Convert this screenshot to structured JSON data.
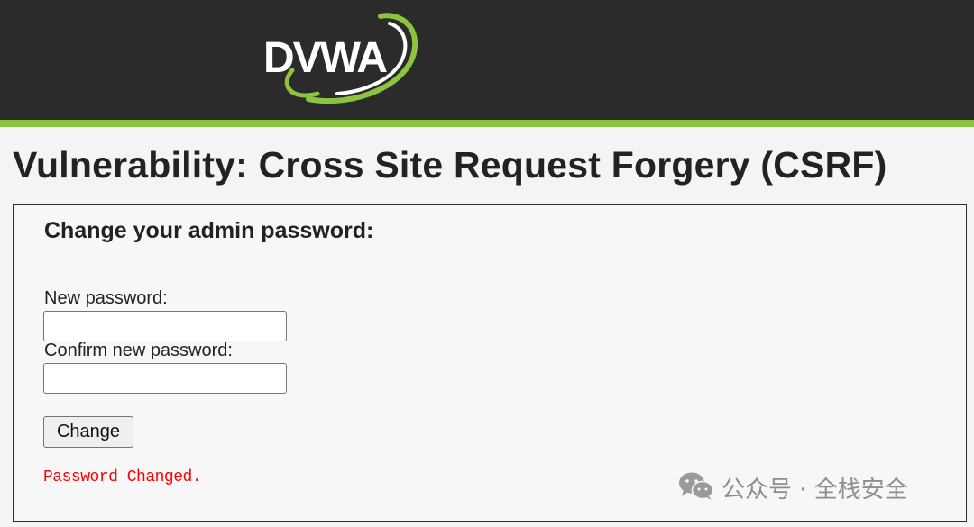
{
  "header": {
    "logo_text": "DVWA",
    "brand_color": "#8cc43f",
    "background_color": "#2b2b2b"
  },
  "page": {
    "title": "Vulnerability: Cross Site Request Forgery (CSRF)"
  },
  "form": {
    "heading": "Change your admin password:",
    "new_password_label": "New password:",
    "new_password_value": "",
    "confirm_password_label": "Confirm new password:",
    "confirm_password_value": "",
    "submit_label": "Change",
    "status_message": "Password Changed.",
    "status_color": "#ff0000"
  },
  "watermark": {
    "icon": "wechat-icon",
    "text": "公众号 · 全栈安全"
  }
}
